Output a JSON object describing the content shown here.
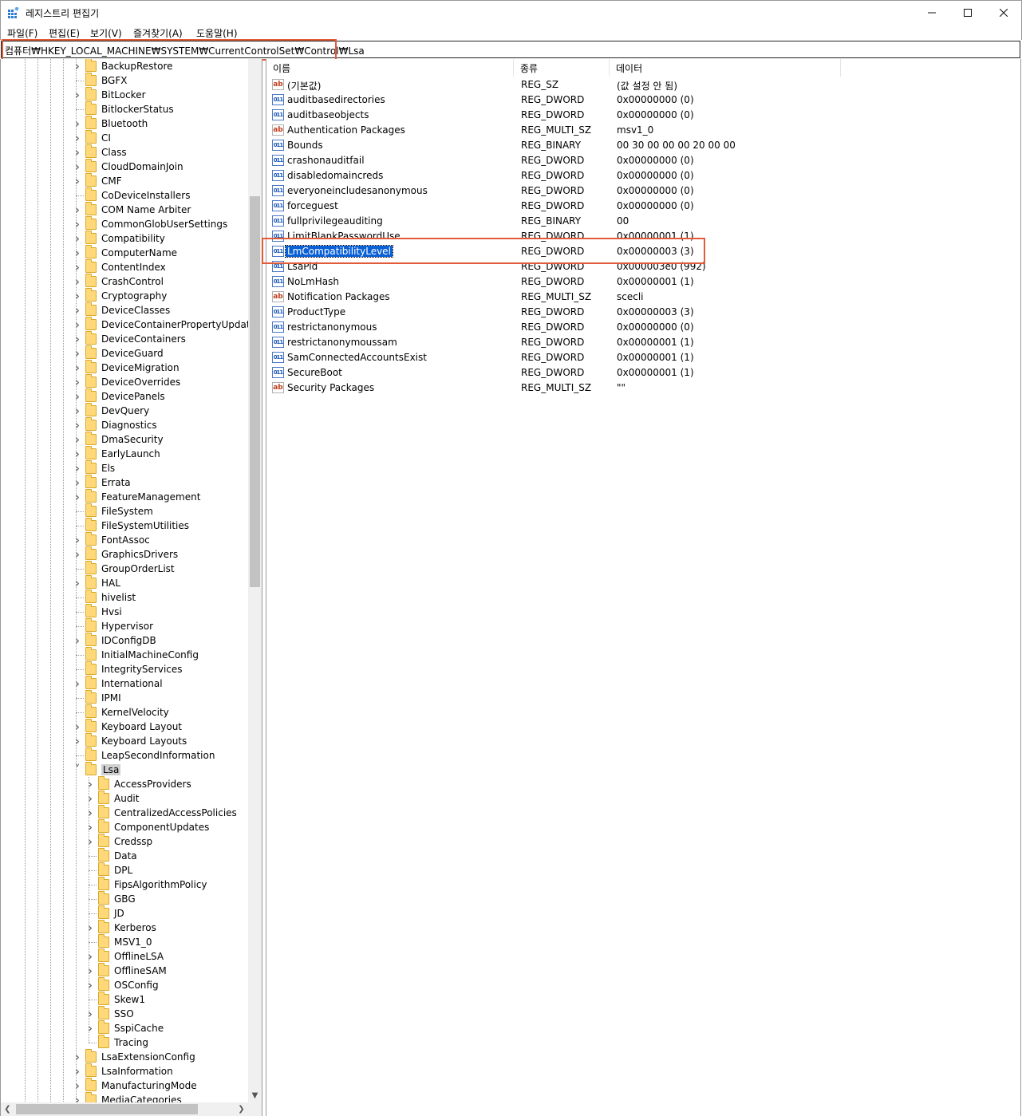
{
  "window": {
    "title": "레지스트리 편집기",
    "minimize": "—",
    "maximize": "☐",
    "close": "✕",
    "accent_color": "#0a60d6",
    "highlight_color": "#e15b3a"
  },
  "menu": [
    "파일(F)",
    "편집(E)",
    "보기(V)",
    "즐겨찾기(A)",
    "도움말(H)"
  ],
  "address": "컴퓨터₩HKEY_LOCAL_MACHINE₩SYSTEM₩CurrentControlSet₩Control₩Lsa",
  "tree": {
    "items": [
      {
        "label": "BackupRestore",
        "expandable": true,
        "level": 1
      },
      {
        "label": "BGFX",
        "expandable": false,
        "level": 1
      },
      {
        "label": "BitLocker",
        "expandable": true,
        "level": 1
      },
      {
        "label": "BitlockerStatus",
        "expandable": false,
        "level": 1
      },
      {
        "label": "Bluetooth",
        "expandable": true,
        "level": 1
      },
      {
        "label": "CI",
        "expandable": true,
        "level": 1
      },
      {
        "label": "Class",
        "expandable": true,
        "level": 1
      },
      {
        "label": "CloudDomainJoin",
        "expandable": true,
        "level": 1
      },
      {
        "label": "CMF",
        "expandable": true,
        "level": 1
      },
      {
        "label": "CoDeviceInstallers",
        "expandable": false,
        "level": 1
      },
      {
        "label": "COM Name Arbiter",
        "expandable": true,
        "level": 1
      },
      {
        "label": "CommonGlobUserSettings",
        "expandable": true,
        "level": 1
      },
      {
        "label": "Compatibility",
        "expandable": true,
        "level": 1
      },
      {
        "label": "ComputerName",
        "expandable": true,
        "level": 1
      },
      {
        "label": "ContentIndex",
        "expandable": true,
        "level": 1
      },
      {
        "label": "CrashControl",
        "expandable": true,
        "level": 1
      },
      {
        "label": "Cryptography",
        "expandable": true,
        "level": 1
      },
      {
        "label": "DeviceClasses",
        "expandable": true,
        "level": 1
      },
      {
        "label": "DeviceContainerPropertyUpdateEve",
        "expandable": true,
        "level": 1
      },
      {
        "label": "DeviceContainers",
        "expandable": true,
        "level": 1
      },
      {
        "label": "DeviceGuard",
        "expandable": true,
        "level": 1
      },
      {
        "label": "DeviceMigration",
        "expandable": true,
        "level": 1
      },
      {
        "label": "DeviceOverrides",
        "expandable": true,
        "level": 1
      },
      {
        "label": "DevicePanels",
        "expandable": true,
        "level": 1
      },
      {
        "label": "DevQuery",
        "expandable": true,
        "level": 1
      },
      {
        "label": "Diagnostics",
        "expandable": true,
        "level": 1
      },
      {
        "label": "DmaSecurity",
        "expandable": true,
        "level": 1
      },
      {
        "label": "EarlyLaunch",
        "expandable": true,
        "level": 1
      },
      {
        "label": "Els",
        "expandable": true,
        "level": 1
      },
      {
        "label": "Errata",
        "expandable": true,
        "level": 1
      },
      {
        "label": "FeatureManagement",
        "expandable": true,
        "level": 1
      },
      {
        "label": "FileSystem",
        "expandable": false,
        "level": 1
      },
      {
        "label": "FileSystemUtilities",
        "expandable": false,
        "level": 1
      },
      {
        "label": "FontAssoc",
        "expandable": true,
        "level": 1
      },
      {
        "label": "GraphicsDrivers",
        "expandable": true,
        "level": 1
      },
      {
        "label": "GroupOrderList",
        "expandable": false,
        "level": 1
      },
      {
        "label": "HAL",
        "expandable": true,
        "level": 1
      },
      {
        "label": "hivelist",
        "expandable": false,
        "level": 1
      },
      {
        "label": "Hvsi",
        "expandable": false,
        "level": 1
      },
      {
        "label": "Hypervisor",
        "expandable": false,
        "level": 1
      },
      {
        "label": "IDConfigDB",
        "expandable": true,
        "level": 1
      },
      {
        "label": "InitialMachineConfig",
        "expandable": false,
        "level": 1
      },
      {
        "label": "IntegrityServices",
        "expandable": false,
        "level": 1
      },
      {
        "label": "International",
        "expandable": true,
        "level": 1
      },
      {
        "label": "IPMI",
        "expandable": false,
        "level": 1
      },
      {
        "label": "KernelVelocity",
        "expandable": false,
        "level": 1
      },
      {
        "label": "Keyboard Layout",
        "expandable": true,
        "level": 1
      },
      {
        "label": "Keyboard Layouts",
        "expandable": true,
        "level": 1
      },
      {
        "label": "LeapSecondInformation",
        "expandable": false,
        "level": 1
      },
      {
        "label": "Lsa",
        "expandable": true,
        "expanded": true,
        "selected": true,
        "level": 1
      },
      {
        "label": "AccessProviders",
        "expandable": true,
        "level": 2
      },
      {
        "label": "Audit",
        "expandable": true,
        "level": 2
      },
      {
        "label": "CentralizedAccessPolicies",
        "expandable": true,
        "level": 2
      },
      {
        "label": "ComponentUpdates",
        "expandable": true,
        "level": 2
      },
      {
        "label": "Credssp",
        "expandable": true,
        "level": 2
      },
      {
        "label": "Data",
        "expandable": false,
        "level": 2
      },
      {
        "label": "DPL",
        "expandable": false,
        "level": 2
      },
      {
        "label": "FipsAlgorithmPolicy",
        "expandable": false,
        "level": 2
      },
      {
        "label": "GBG",
        "expandable": false,
        "level": 2
      },
      {
        "label": "JD",
        "expandable": false,
        "level": 2
      },
      {
        "label": "Kerberos",
        "expandable": true,
        "level": 2
      },
      {
        "label": "MSV1_0",
        "expandable": false,
        "level": 2
      },
      {
        "label": "OfflineLSA",
        "expandable": true,
        "level": 2
      },
      {
        "label": "OfflineSAM",
        "expandable": true,
        "level": 2
      },
      {
        "label": "OSConfig",
        "expandable": true,
        "level": 2
      },
      {
        "label": "Skew1",
        "expandable": false,
        "level": 2
      },
      {
        "label": "SSO",
        "expandable": true,
        "level": 2
      },
      {
        "label": "SspiCache",
        "expandable": true,
        "level": 2
      },
      {
        "label": "Tracing",
        "expandable": false,
        "level": 2
      },
      {
        "label": "LsaExtensionConfig",
        "expandable": true,
        "level": 1
      },
      {
        "label": "LsaInformation",
        "expandable": true,
        "level": 1
      },
      {
        "label": "ManufacturingMode",
        "expandable": true,
        "level": 1
      },
      {
        "label": "MediaCategories",
        "expandable": true,
        "level": 1
      }
    ]
  },
  "list": {
    "headers": {
      "name": "이름",
      "type": "종류",
      "data": "데이터"
    },
    "rows": [
      {
        "icon": "string-value-icon",
        "name": "(기본값)",
        "type": "REG_SZ",
        "data": "(값 설정 안 됨)"
      },
      {
        "icon": "binary-value-icon",
        "name": "auditbasedirectories",
        "type": "REG_DWORD",
        "data": "0x00000000 (0)"
      },
      {
        "icon": "binary-value-icon",
        "name": "auditbaseobjects",
        "type": "REG_DWORD",
        "data": "0x00000000 (0)"
      },
      {
        "icon": "string-value-icon",
        "name": "Authentication Packages",
        "type": "REG_MULTI_SZ",
        "data": "msv1_0"
      },
      {
        "icon": "binary-value-icon",
        "name": "Bounds",
        "type": "REG_BINARY",
        "data": "00 30 00 00 00 20 00 00"
      },
      {
        "icon": "binary-value-icon",
        "name": "crashonauditfail",
        "type": "REG_DWORD",
        "data": "0x00000000 (0)"
      },
      {
        "icon": "binary-value-icon",
        "name": "disabledomaincreds",
        "type": "REG_DWORD",
        "data": "0x00000000 (0)"
      },
      {
        "icon": "binary-value-icon",
        "name": "everyoneincludesanonymous",
        "type": "REG_DWORD",
        "data": "0x00000000 (0)"
      },
      {
        "icon": "binary-value-icon",
        "name": "forceguest",
        "type": "REG_DWORD",
        "data": "0x00000000 (0)"
      },
      {
        "icon": "binary-value-icon",
        "name": "fullprivilegeauditing",
        "type": "REG_BINARY",
        "data": "00"
      },
      {
        "icon": "binary-value-icon",
        "name": "LimitBlankPasswordUse",
        "type": "REG_DWORD",
        "data": "0x00000001 (1)"
      },
      {
        "icon": "binary-value-icon",
        "name": "LmCompatibilityLevel",
        "type": "REG_DWORD",
        "data": "0x00000003 (3)",
        "selected": true
      },
      {
        "icon": "binary-value-icon",
        "name": "LsaPid",
        "type": "REG_DWORD",
        "data": "0x000003e0 (992)"
      },
      {
        "icon": "binary-value-icon",
        "name": "NoLmHash",
        "type": "REG_DWORD",
        "data": "0x00000001 (1)"
      },
      {
        "icon": "string-value-icon",
        "name": "Notification Packages",
        "type": "REG_MULTI_SZ",
        "data": "scecli"
      },
      {
        "icon": "binary-value-icon",
        "name": "ProductType",
        "type": "REG_DWORD",
        "data": "0x00000003 (3)"
      },
      {
        "icon": "binary-value-icon",
        "name": "restrictanonymous",
        "type": "REG_DWORD",
        "data": "0x00000000 (0)"
      },
      {
        "icon": "binary-value-icon",
        "name": "restrictanonymoussam",
        "type": "REG_DWORD",
        "data": "0x00000001 (1)"
      },
      {
        "icon": "binary-value-icon",
        "name": "SamConnectedAccountsExist",
        "type": "REG_DWORD",
        "data": "0x00000001 (1)"
      },
      {
        "icon": "binary-value-icon",
        "name": "SecureBoot",
        "type": "REG_DWORD",
        "data": "0x00000001 (1)"
      },
      {
        "icon": "string-value-icon",
        "name": "Security Packages",
        "type": "REG_MULTI_SZ",
        "data": "\"\""
      }
    ]
  }
}
